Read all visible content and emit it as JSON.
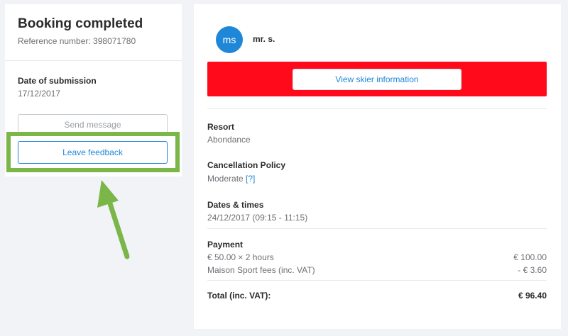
{
  "booking": {
    "title": "Booking completed",
    "reference": "Reference number: 398071780",
    "date_label": "Date of submission",
    "date_value": "17/12/2017",
    "send_message": "Send message",
    "leave_feedback": "Leave feedback"
  },
  "client": {
    "initials": "ms",
    "name": "mr. s.",
    "view_button": "View skier information"
  },
  "details": {
    "resort_label": "Resort",
    "resort_value": "Abondance",
    "cancel_label": "Cancellation Policy",
    "cancel_value": "Moderate",
    "cancel_help": "[?]",
    "dates_label": "Dates & times",
    "dates_value": "24/12/2017 (09:15 - 11:15)"
  },
  "payment": {
    "label": "Payment",
    "lines": [
      {
        "desc": "€ 50.00 × 2 hours",
        "amount": "€ 100.00"
      },
      {
        "desc": "Maison Sport fees (inc. VAT)",
        "amount": "- € 3.60"
      }
    ],
    "total_label": "Total (inc. VAT):",
    "total_amount": "€ 96.40"
  },
  "colors": {
    "accent": "#1f87d8",
    "banner": "#ff0a1a",
    "annotation": "#7ab648"
  }
}
